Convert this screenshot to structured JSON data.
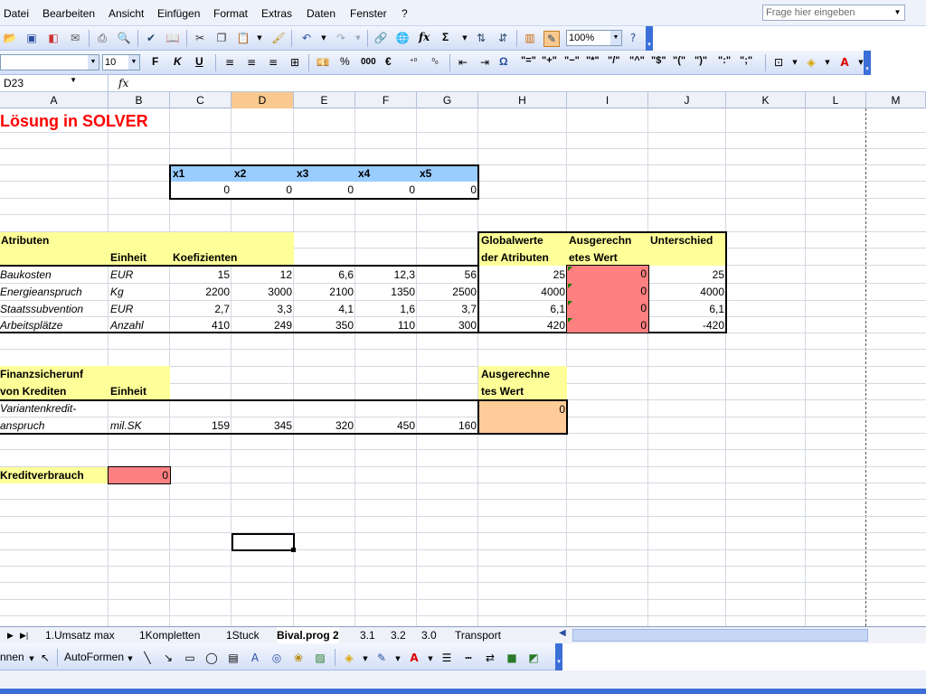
{
  "menubar": {
    "items": [
      "Datei",
      "Bearbeiten",
      "Ansicht",
      "Einfügen",
      "Format",
      "Extras",
      "Daten",
      "Fenster",
      "?"
    ],
    "help_placeholder": "Frage hier eingeben"
  },
  "toolbar1": {
    "zoom": "100%",
    "sigma": "Σ",
    "fx": "fx"
  },
  "toolbar2": {
    "font_size": "10",
    "bold": "F",
    "italic": "K",
    "underline": "U",
    "percent": "%",
    "thousands": "000",
    "euro": "€",
    "omega": "Ω",
    "symbols": [
      "\"=\"",
      "\"+\"",
      "\"−\"",
      "\"*\"",
      "\"/\"",
      "\"^\"",
      "\"$\"",
      "\"(\"",
      "\")\"",
      "\":\"",
      "\";\""
    ]
  },
  "formulabar": {
    "cell_ref": "D23",
    "fx": "fx",
    "content": ""
  },
  "columns": [
    "A",
    "B",
    "C",
    "D",
    "E",
    "F",
    "G",
    "H",
    "I",
    "J",
    "K",
    "L",
    "M"
  ],
  "active_column": "D",
  "sheet": {
    "title": "Lösung in SOLVER",
    "x_headers": [
      "x1",
      "x2",
      "x3",
      "x4",
      "x5"
    ],
    "x_values": [
      "0",
      "0",
      "0",
      "0",
      "0"
    ],
    "attr_header": "Atributen",
    "unit_header": "Einheit",
    "coef_header": "Koefizienten",
    "global_header_1": "Globalwerte",
    "global_header_2": "der Atributen",
    "calc_header_1": "Ausgerechn",
    "calc_header_2": "etes Wert",
    "diff_header": "Unterschied",
    "rows": [
      {
        "name": "Baukosten",
        "unit": "EUR",
        "coefs": [
          "15",
          "12",
          "6,6",
          "12,3",
          "56"
        ],
        "global": "25",
        "calc": "0",
        "diff": "25"
      },
      {
        "name": "Energieanspruch",
        "unit": "Kg",
        "coefs": [
          "2200",
          "3000",
          "2100",
          "1350",
          "2500"
        ],
        "global": "4000",
        "calc": "0",
        "diff": "4000"
      },
      {
        "name": "Staatssubvention",
        "unit": "EUR",
        "coefs": [
          "2,7",
          "3,3",
          "4,1",
          "1,6",
          "3,7"
        ],
        "global": "6,1",
        "calc": "0",
        "diff": "6,1"
      },
      {
        "name": "Arbeitsplätze",
        "unit": "Anzahl",
        "coefs": [
          "410",
          "249",
          "350",
          "110",
          "300"
        ],
        "global": "420",
        "calc": "0",
        "diff": "-420"
      }
    ],
    "finance_header_1": "Finanzsicherunf",
    "finance_header_2": "von Krediten",
    "finance_unit_header": "Einheit",
    "finance_calc_header_1": "Ausgerechne",
    "finance_calc_header_2": "tes Wert",
    "credit_name_1": "Variantenkredit-",
    "credit_name_2": "anspruch",
    "credit_unit": "mil.SK",
    "credit_values": [
      "159",
      "345",
      "320",
      "450",
      "160"
    ],
    "credit_calc": "0",
    "usage_label": "Kreditverbrauch",
    "usage_value": "0"
  },
  "tabs": {
    "items": [
      "1.Umsatz max",
      "1Kompletten",
      "1Stuck",
      "Bival.prog 2",
      "3.1",
      "3.2",
      "3.0",
      "Transport"
    ],
    "selected": "Bival.prog 2"
  },
  "drawbar": {
    "zeichnen": "nnen",
    "autoformen": "AutoFormen"
  }
}
